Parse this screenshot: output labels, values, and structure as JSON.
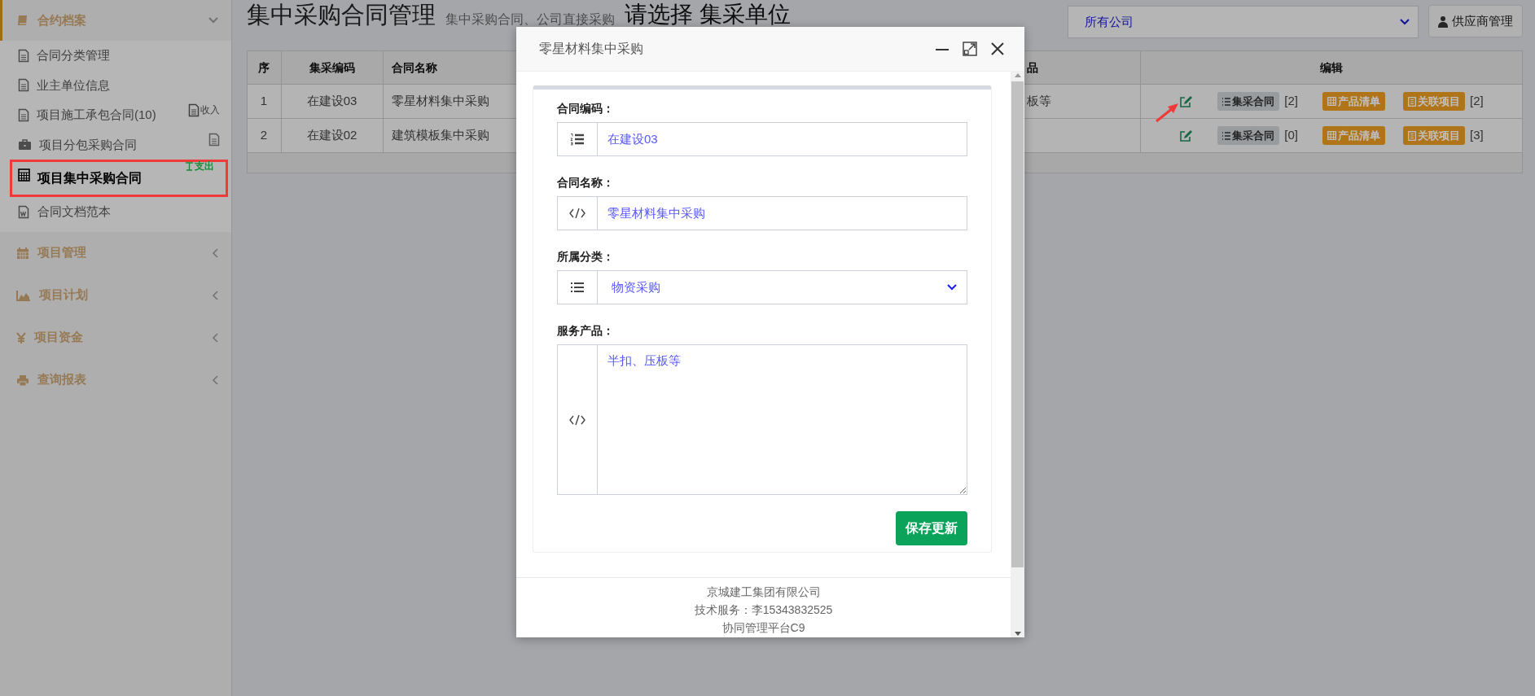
{
  "sidebar": {
    "sections": [
      {
        "label": "合约档案",
        "selected": true,
        "expanded": true,
        "items": [
          {
            "label": "合同分类管理",
            "kind": "plain",
            "selected": false,
            "highlighted": false
          },
          {
            "label": "业主单位信息",
            "kind": "plain",
            "selected": false,
            "highlighted": false
          },
          {
            "label": "项目施工承包合同(10)",
            "kind": "income",
            "tag": "收入",
            "selected": false,
            "highlighted": false
          },
          {
            "label": "项目分包采购合同",
            "kind": "doc",
            "selected": false,
            "highlighted": false
          },
          {
            "label": "项目集中采购合同",
            "kind": "expense",
            "tag": "支出",
            "selected": true,
            "highlighted": true
          },
          {
            "label": "合同文档范本",
            "kind": "plain",
            "selected": false,
            "highlighted": false
          }
        ]
      },
      {
        "label": "项目管理",
        "selected": false,
        "expanded": false
      },
      {
        "label": "项目计划",
        "selected": false,
        "expanded": false
      },
      {
        "label": "项目资金",
        "selected": false,
        "expanded": false
      },
      {
        "label": "查询报表",
        "selected": false,
        "expanded": false
      }
    ]
  },
  "header": {
    "title": "集中采购合同管理",
    "subtitle": "集中采购合同、公司直接采购",
    "prompt": "请选择 集采单位",
    "company_select": {
      "value": "所有公司"
    },
    "supplier_button": "供应商管理"
  },
  "table": {
    "columns": [
      "序",
      "集采编码",
      "合同名称",
      "品",
      "编辑"
    ],
    "rows": [
      {
        "index": "1",
        "code": "在建设03",
        "name": "零星材料集中采购",
        "product": "板等",
        "pointed": true,
        "contracts_button": "集采合同",
        "contracts_count": "[2]",
        "products_button": "产品清单",
        "projects_button": "关联项目",
        "projects_count": "[2]"
      },
      {
        "index": "2",
        "code": "在建设02",
        "name": "建筑模板集中采购",
        "pointed": false,
        "contracts_button": "集采合同",
        "contracts_count": "[0]",
        "products_button": "产品清单",
        "projects_button": "关联项目",
        "projects_count": "[3]"
      }
    ]
  },
  "modal": {
    "title": "零星材料集中采购",
    "fields": [
      {
        "kind": "text",
        "label": "合同编码：",
        "value": "在建设03"
      },
      {
        "kind": "text",
        "label": "合同名称：",
        "value": "零星材料集中采购"
      },
      {
        "kind": "select",
        "label": "所属分类：",
        "value": "物资采购"
      },
      {
        "kind": "textarea",
        "label": "服务产品：",
        "value": "半扣、压板等"
      }
    ],
    "save_button": "保存更新",
    "footer": [
      "京城建工集团有限公司",
      "技术服务：李15343832525",
      "协同管理平台C9"
    ]
  }
}
